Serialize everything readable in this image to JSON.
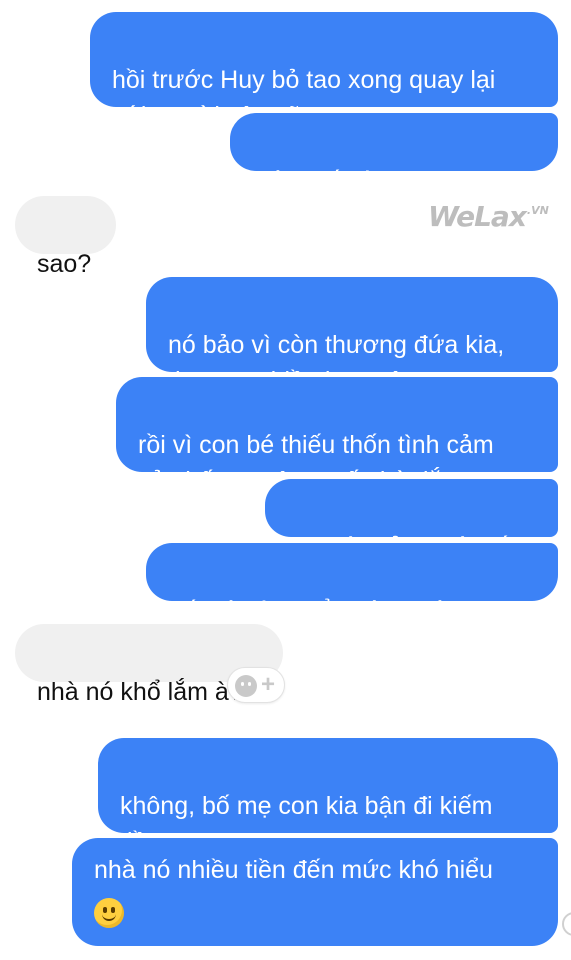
{
  "watermark": {
    "brand": "WeLax",
    "suffix": ".VN"
  },
  "messages": [
    {
      "side": "sent",
      "text": "hồi trước Huy bỏ tao xong quay lại\nvới người yêu cũ"
    },
    {
      "side": "sent",
      "text": "mày biết vì sao không?"
    },
    {
      "side": "received",
      "text": "sao?"
    },
    {
      "side": "sent",
      "text": "nó bảo vì còn thương đứa kia,\nthương nhiều hơn yêu"
    },
    {
      "side": "sent",
      "text": "rồi vì con bé thiếu thốn tình cảm\ncủa bố mẹ nên muốn bù đắp"
    },
    {
      "side": "sent",
      "text": "tao cứ tưởng nói dối"
    },
    {
      "side": "sent",
      "text": "đến lúc tìm hiểu hóa ra là thật"
    },
    {
      "side": "received",
      "text": "nhà nó khổ lắm à?"
    },
    {
      "side": "sent",
      "text": "không, bố mẹ con kia bận đi kiếm\ntiền"
    },
    {
      "side": "sent",
      "text": "nhà nó nhiều tiền đến mức khó hiểu",
      "emoji": "slightly-smiling-face-emoji"
    }
  ],
  "reaction_button": {
    "icon": "smiley-icon",
    "plus": "+"
  }
}
